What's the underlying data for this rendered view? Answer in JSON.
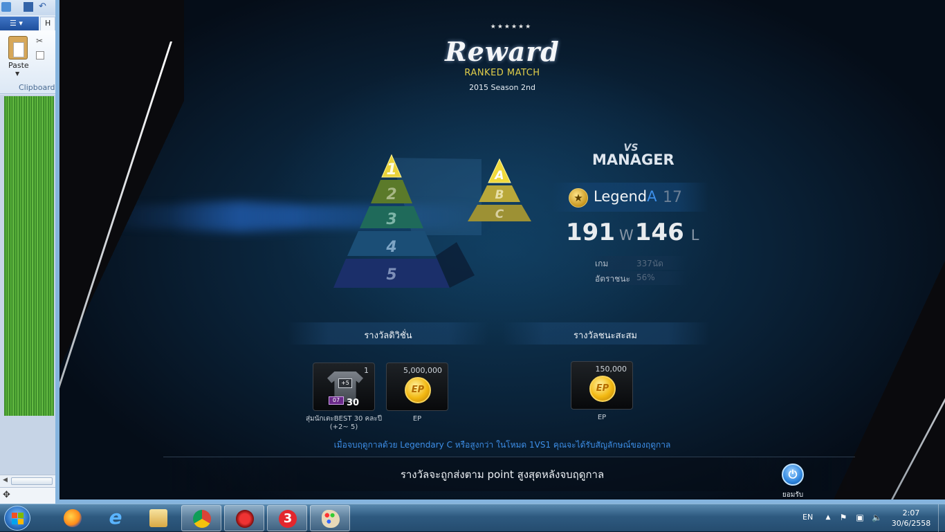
{
  "paint": {
    "file_tab": "",
    "home_tab": "H",
    "paste_label": "Paste",
    "clipboard_label": "Clipboard"
  },
  "game": {
    "title": "Reward",
    "subtitle": "RANKED MATCH",
    "season": "2015 Season 2nd",
    "mode_vs": "VS",
    "mode_manager": "MANAGER",
    "rank": {
      "name": "Legend",
      "suffix": "A",
      "points": "17"
    },
    "record": {
      "wins": "191",
      "wins_label": "W",
      "losses": "146",
      "losses_label": "L"
    },
    "stats": [
      {
        "key": "เกม",
        "value": "337นัด"
      },
      {
        "key": "อัตราชนะ",
        "value": "56%"
      }
    ],
    "pyramid_left": [
      "1",
      "2",
      "3",
      "4",
      "5"
    ],
    "pyramid_right": [
      "A",
      "B",
      "C"
    ],
    "division_reward_title": "รางวัลดิวิชั่น",
    "cumulative_reward_title": "รางวัลชนะสะสม",
    "division_rewards": [
      {
        "qty": "1",
        "badge": "+5",
        "number": "30",
        "tag": "07",
        "label": "สุ่มนักเตะBEST 30 คละปี (+2~ 5)"
      },
      {
        "qty": "5,000,000",
        "coin": "EP",
        "label": "EP"
      }
    ],
    "cumulative_rewards": [
      {
        "qty": "150,000",
        "coin": "EP",
        "label": "EP"
      }
    ],
    "notice": "เมื่อจบฤดูกาลด้วย Legendary C หรือสูงกว่า ในโหมด 1VS1 คุณจะได้รับสัญลักษณ์ของฤดูกาล",
    "bottom_message": "รางวัลจะถูกส่งตาม point สูงสุดหลังจบฤดูกาล",
    "confirm_label": "ยอมรับ"
  },
  "taskbar": {
    "apps": [
      "firefox-icon",
      "internet-explorer-icon",
      "file-explorer-icon",
      "chrome-icon",
      "game-client-icon",
      "channel-3-icon",
      "paint-icon"
    ],
    "language": "EN",
    "time": "2:07",
    "date": "30/6/2558"
  },
  "colors": {
    "accent_blue": "#3d8fe8",
    "gold": "#e2cf4a",
    "background": "#0a2238"
  }
}
